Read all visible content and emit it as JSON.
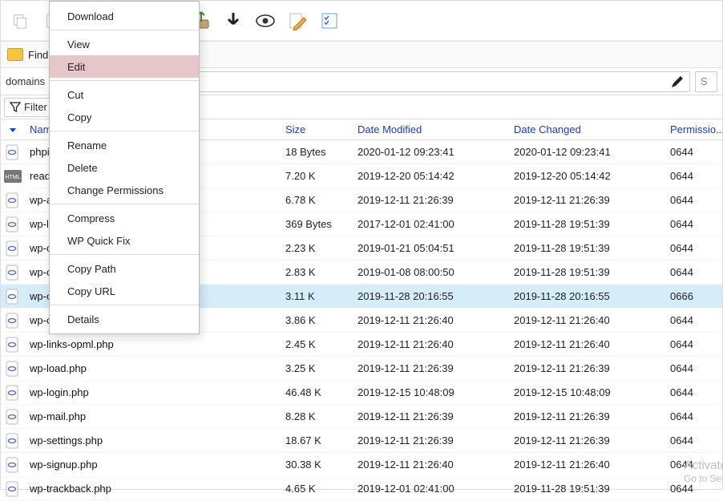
{
  "find_label": "Find",
  "breadcrumbs": [
    "domains"
  ],
  "breadcrumb_sep": "›",
  "side_hint": "S",
  "filter_label": "Filter",
  "columns": {
    "name": "Name",
    "size": "Size",
    "modified": "Date Modified",
    "changed": "Date Changed",
    "perm": "Permissio..."
  },
  "files": [
    {
      "icon": "php",
      "name": "phpi",
      "size": "18 Bytes",
      "modified": "2020-01-12 09:23:41",
      "changed": "2020-01-12 09:23:41",
      "perm": "0644"
    },
    {
      "icon": "html",
      "name": "read",
      "size": "7.20 K",
      "modified": "2019-12-20 05:14:42",
      "changed": "2019-12-20 05:14:42",
      "perm": "0644"
    },
    {
      "icon": "php",
      "name": "wp-a",
      "size": "6.78 K",
      "modified": "2019-12-11 21:26:39",
      "changed": "2019-12-11 21:26:39",
      "perm": "0644"
    },
    {
      "icon": "php",
      "name": "wp-l",
      "size": "369 Bytes",
      "modified": "2017-12-01 02:41:00",
      "changed": "2019-11-28 19:51:39",
      "perm": "0644"
    },
    {
      "icon": "php",
      "name": "wp-c",
      "size": "2.23 K",
      "modified": "2019-01-21 05:04:51",
      "changed": "2019-11-28 19:51:39",
      "perm": "0644"
    },
    {
      "icon": "php",
      "name": "wp-c",
      "size": "2.83 K",
      "modified": "2019-01-08 08:00:50",
      "changed": "2019-11-28 19:51:39",
      "perm": "0644"
    },
    {
      "icon": "php",
      "name": "wp-c",
      "size": "3.11 K",
      "modified": "2019-11-28 20:16:55",
      "changed": "2019-11-28 20:16:55",
      "perm": "0666",
      "selected": true
    },
    {
      "icon": "php",
      "name": "wp-cron.php",
      "size": "3.86 K",
      "modified": "2019-12-11 21:26:40",
      "changed": "2019-12-11 21:26:40",
      "perm": "0644"
    },
    {
      "icon": "php",
      "name": "wp-links-opml.php",
      "size": "2.45 K",
      "modified": "2019-12-11 21:26:40",
      "changed": "2019-12-11 21:26:40",
      "perm": "0644"
    },
    {
      "icon": "php",
      "name": "wp-load.php",
      "size": "3.25 K",
      "modified": "2019-12-11 21:26:39",
      "changed": "2019-12-11 21:26:39",
      "perm": "0644"
    },
    {
      "icon": "php",
      "name": "wp-login.php",
      "size": "46.48 K",
      "modified": "2019-12-15 10:48:09",
      "changed": "2019-12-15 10:48:09",
      "perm": "0644"
    },
    {
      "icon": "php",
      "name": "wp-mail.php",
      "size": "8.28 K",
      "modified": "2019-12-11 21:26:39",
      "changed": "2019-12-11 21:26:39",
      "perm": "0644"
    },
    {
      "icon": "php",
      "name": "wp-settings.php",
      "size": "18.67 K",
      "modified": "2019-12-11 21:26:39",
      "changed": "2019-12-11 21:26:39",
      "perm": "0644"
    },
    {
      "icon": "php",
      "name": "wp-signup.php",
      "size": "30.38 K",
      "modified": "2019-12-11 21:26:40",
      "changed": "2019-12-11 21:26:40",
      "perm": "0644"
    },
    {
      "icon": "php",
      "name": "wp-trackback.php",
      "size": "4.65 K",
      "modified": "2019-12-01 02:41:00",
      "changed": "2019-11-28 19:51:39",
      "perm": "0644"
    }
  ],
  "context_menu": [
    {
      "label": "Download"
    },
    {
      "sep": true
    },
    {
      "label": "View"
    },
    {
      "label": "Edit",
      "hover": true
    },
    {
      "sep": true
    },
    {
      "label": "Cut"
    },
    {
      "label": "Copy"
    },
    {
      "sep": true
    },
    {
      "label": "Rename"
    },
    {
      "label": "Delete"
    },
    {
      "label": "Change Permissions"
    },
    {
      "sep": true
    },
    {
      "label": "Compress"
    },
    {
      "label": "WP Quick Fix"
    },
    {
      "sep": true
    },
    {
      "label": "Copy Path"
    },
    {
      "label": "Copy URL"
    },
    {
      "sep": true
    },
    {
      "label": "Details"
    }
  ],
  "watermark": {
    "line1": "Activate",
    "line2": "Go to Sett"
  }
}
